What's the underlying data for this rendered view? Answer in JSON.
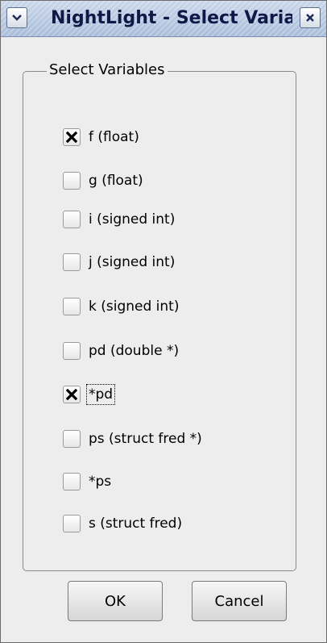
{
  "window": {
    "title": "NightLight - Select Variables"
  },
  "group": {
    "legend": "Select Variables"
  },
  "variables": [
    {
      "label": "f (float)",
      "checked": true
    },
    {
      "label": "g (float)",
      "checked": false
    },
    {
      "label": "i (signed int)",
      "checked": false
    },
    {
      "label": "j (signed int)",
      "checked": false
    },
    {
      "label": "k (signed int)",
      "checked": false
    },
    {
      "label": "pd (double *)",
      "checked": false
    },
    {
      "label": "*pd",
      "checked": true
    },
    {
      "label": "ps (struct fred *)",
      "checked": false
    },
    {
      "label": "*ps",
      "checked": false
    },
    {
      "label": "s (struct fred)",
      "checked": false
    }
  ],
  "buttons": {
    "ok_label": "OK",
    "cancel_label": "Cancel"
  },
  "icons": {
    "menu": "chevron-down-icon",
    "close": "close-icon",
    "check": "check-x-icon"
  }
}
